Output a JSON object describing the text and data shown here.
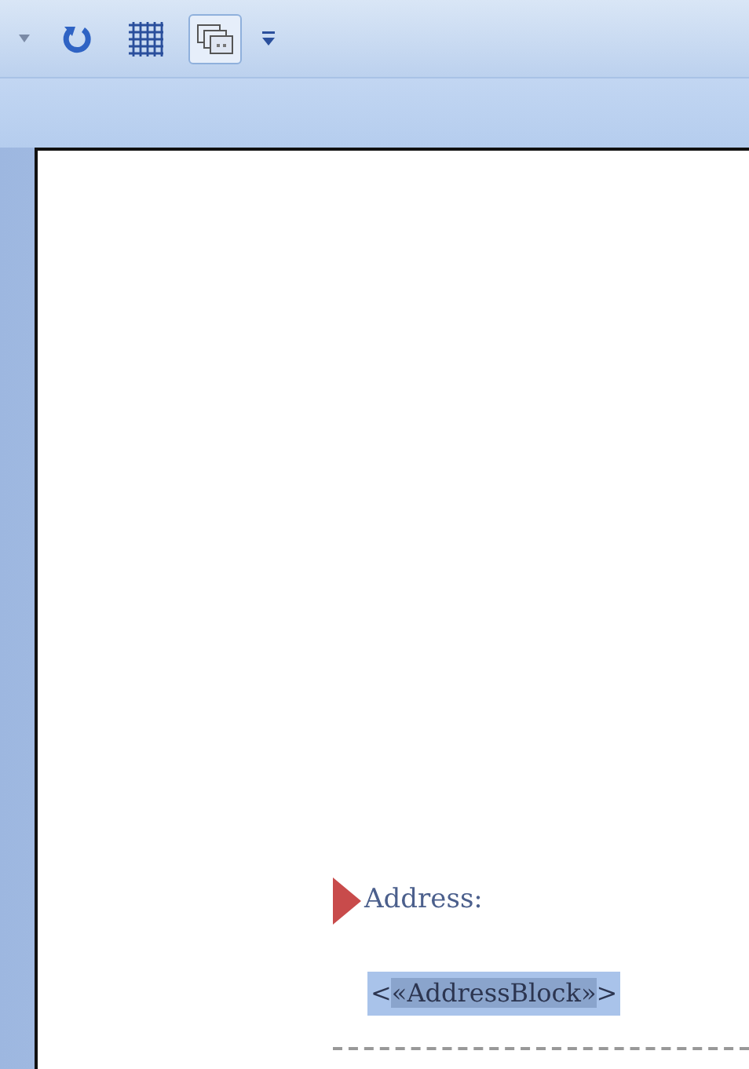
{
  "toolbar": {
    "items": [
      {
        "kind": "dropdown",
        "selected": false
      },
      {
        "kind": "undo",
        "selected": false
      },
      {
        "kind": "grid",
        "selected": false
      },
      {
        "kind": "windows",
        "selected": true
      },
      {
        "kind": "customize",
        "selected": false
      }
    ]
  },
  "document": {
    "heading": "Address:",
    "merge_field": [
      {
        "text": "<",
        "kind": "bracket"
      },
      {
        "text": "«AddressBlock»",
        "kind": "field"
      },
      {
        "text": ">",
        "kind": "bracket"
      }
    ]
  }
}
